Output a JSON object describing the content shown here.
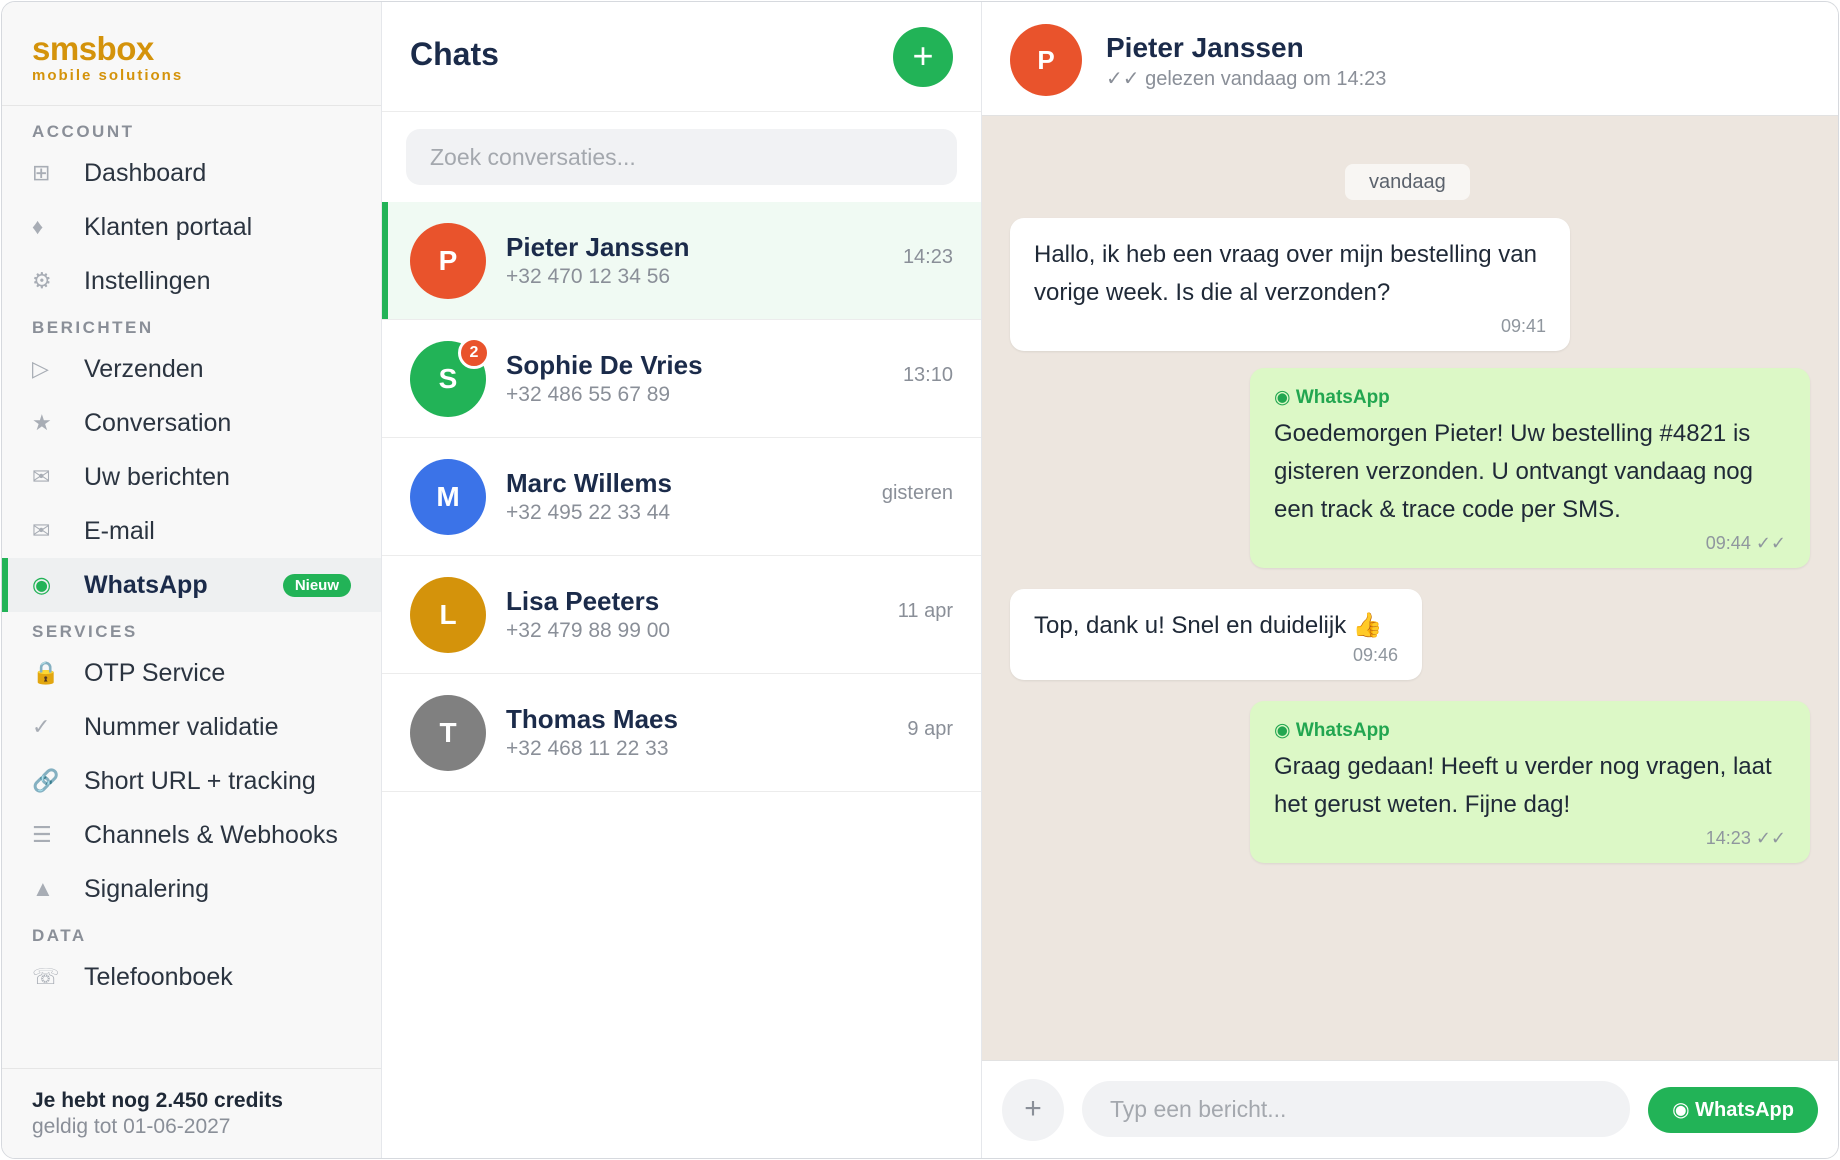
{
  "brand": {
    "name": "smsbox",
    "tagline": "mobile solutions",
    "color": "#d4930b"
  },
  "sidebar": {
    "sections": [
      {
        "title": "ACCOUNT",
        "items": [
          {
            "icon": "⊞",
            "icon_name": "dashboard-grid-icon",
            "label": "Dashboard"
          },
          {
            "icon": "♦",
            "icon_name": "portal-diamond-icon",
            "label": "Klanten portaal"
          },
          {
            "icon": "⚙",
            "icon_name": "gear-icon",
            "label": "Instellingen"
          }
        ]
      },
      {
        "title": "BERICHTEN",
        "items": [
          {
            "icon": "▷",
            "icon_name": "send-icon",
            "label": "Verzenden"
          },
          {
            "icon": "★",
            "icon_name": "star-icon",
            "label": "Conversation"
          },
          {
            "icon": "✉",
            "icon_name": "envelope-icon",
            "label": "Uw berichten"
          },
          {
            "icon": "✉",
            "icon_name": "email-icon",
            "label": "E-mail"
          },
          {
            "icon": "◉",
            "icon_name": "whatsapp-icon",
            "label": "WhatsApp",
            "badge": "Nieuw",
            "active": true
          }
        ]
      },
      {
        "title": "SERVICES",
        "items": [
          {
            "icon": "🔒",
            "icon_name": "lock-icon",
            "label": "OTP Service"
          },
          {
            "icon": "✓",
            "icon_name": "check-icon",
            "label": "Nummer validatie"
          },
          {
            "icon": "🔗",
            "icon_name": "link-icon",
            "label": "Short URL + tracking"
          },
          {
            "icon": "☰",
            "icon_name": "list-icon",
            "label": "Channels & Webhooks"
          },
          {
            "icon": "▲",
            "icon_name": "warning-triangle-icon",
            "label": "Signalering"
          }
        ]
      },
      {
        "title": "DATA",
        "items": [
          {
            "icon": "☏",
            "icon_name": "phone-icon",
            "label": "Telefoonboek"
          }
        ]
      }
    ],
    "credits": {
      "main": "Je hebt nog 2.450 credits",
      "sub": "geldig tot 01-06-2027"
    }
  },
  "chatlist": {
    "title": "Chats",
    "new_button": "+",
    "search_placeholder": "Zoek conversaties...",
    "chats": [
      {
        "initial": "P",
        "name": "Pieter Janssen",
        "phone": "+32 470 12 34 56",
        "time": "14:23",
        "color": "#e9532c",
        "selected": true
      },
      {
        "initial": "S",
        "name": "Sophie De Vries",
        "phone": "+32 486 55 67 89",
        "time": "13:10",
        "color": "#22b357",
        "unread": "2"
      },
      {
        "initial": "M",
        "name": "Marc Willems",
        "phone": "+32 495 22 33 44",
        "time": "gisteren",
        "color": "#3b73e8"
      },
      {
        "initial": "L",
        "name": "Lisa Peeters",
        "phone": "+32 479 88 99 00",
        "time": "11 apr",
        "color": "#d4930b"
      },
      {
        "initial": "T",
        "name": "Thomas Maes",
        "phone": "+32 468 11 22 33",
        "time": "9 apr",
        "color": "#808080"
      }
    ]
  },
  "conversation": {
    "contact": {
      "initial": "P",
      "name": "Pieter Janssen",
      "status": "✓✓ gelezen vandaag om 14:23",
      "color": "#e9532c"
    },
    "date_label": "vandaag",
    "messages": [
      {
        "direction": "in",
        "text": "Hallo, ik heb een vraag over mijn bestelling van vorige week. Is die al verzonden?",
        "time": "09:41"
      },
      {
        "direction": "out",
        "channel": "◉ WhatsApp",
        "text": "Goedemorgen Pieter! Uw bestelling #4821 is gisteren verzonden. U ontvangt vandaag nog een track & trace code per SMS.",
        "time": "09:44 ✓✓"
      },
      {
        "direction": "in",
        "text": "Top, dank u! Snel en duidelijk 👍",
        "time": "09:46"
      },
      {
        "direction": "out",
        "channel": "◉ WhatsApp",
        "text": "Graag gedaan! Heeft u verder nog vragen, laat het gerust weten. Fijne dag!",
        "time": "14:23 ✓✓"
      }
    ],
    "composer": {
      "attach": "+",
      "placeholder": "Typ een bericht...",
      "send_label": "◉ WhatsApp"
    }
  },
  "colors": {
    "accent": "#22b357",
    "outgoing_bubble": "#dcf8c6",
    "chat_bg": "#ede6df"
  }
}
